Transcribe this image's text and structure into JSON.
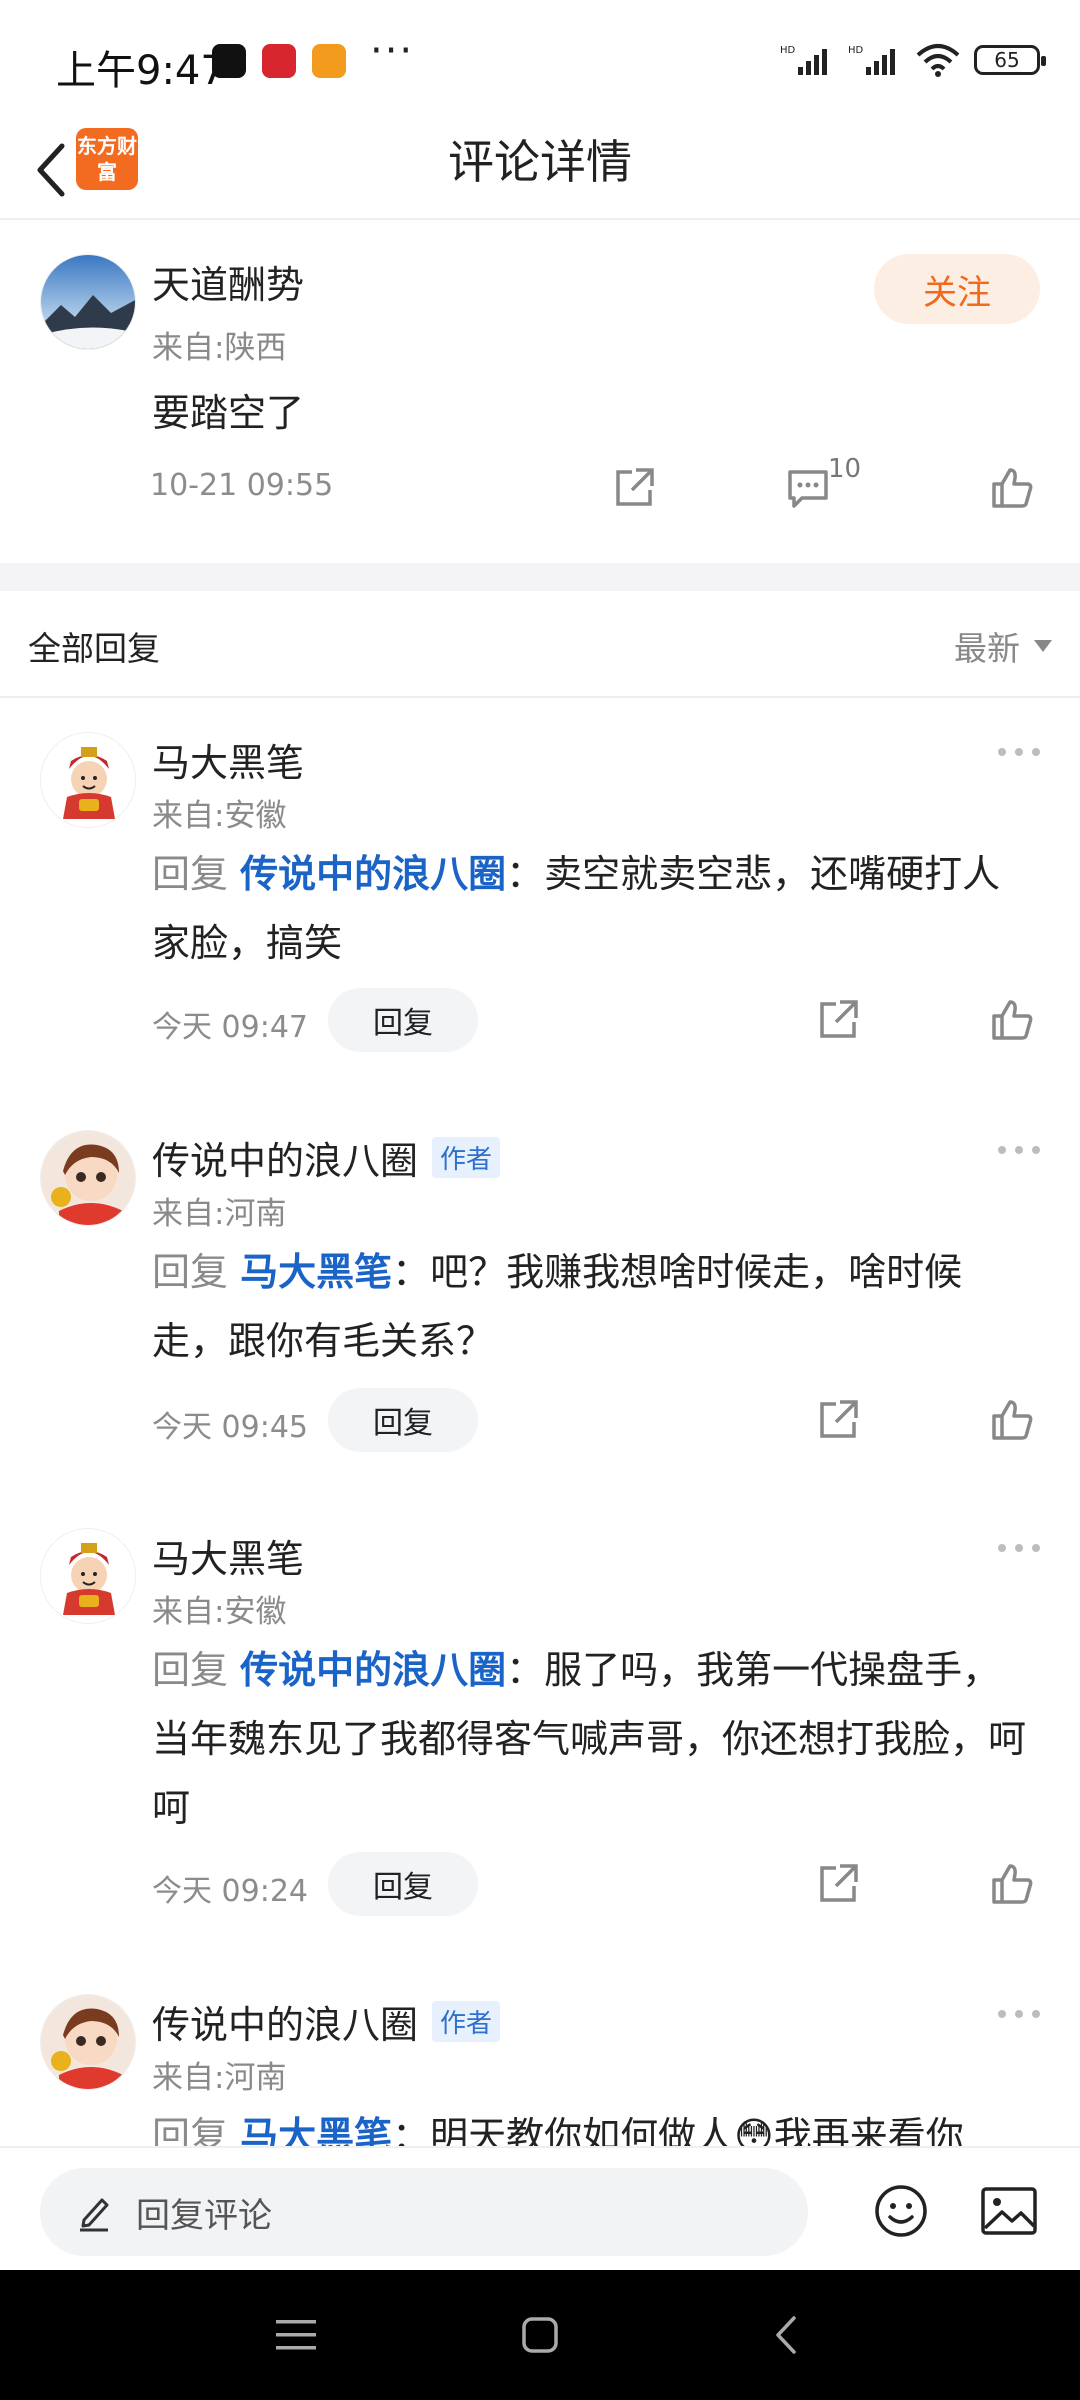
{
  "status_bar": {
    "time": "上午9:47",
    "more": "···",
    "battery": "65"
  },
  "header": {
    "logo_text": "东方财富",
    "title": "评论详情"
  },
  "post": {
    "author": "天道酬势",
    "location": "来自:陕西",
    "content": "要踏空了",
    "time": "10-21 09:55",
    "follow_label": "关注",
    "comment_count": "10"
  },
  "replies": {
    "title": "全部回复",
    "sort_label": "最新",
    "items": [
      {
        "author": "马大黑笔",
        "location": "来自:安徽",
        "reply_word": "回复",
        "mention": "传说中的浪八圈",
        "text": "卖空就卖空悲，还嘴硬打人家脸，搞笑",
        "time": "今天 09:47",
        "reply_button": "回复"
      },
      {
        "author": "传说中的浪八圈",
        "badge": "作者",
        "location": "来自:河南",
        "reply_word": "回复",
        "mention": "马大黑笔",
        "text": "吧？我赚我想啥时候走，啥时候走，跟你有毛关系？",
        "time": "今天 09:45",
        "reply_button": "回复"
      },
      {
        "author": "马大黑笔",
        "location": "来自:安徽",
        "reply_word": "回复",
        "mention": "传说中的浪八圈",
        "text": "服了吗，我第一代操盘手，当年魏东见了我都得客气喊声哥，你还想打我脸，呵呵",
        "time": "今天 09:24",
        "reply_button": "回复"
      },
      {
        "author": "传说中的浪八圈",
        "badge": "作者",
        "location": "来自:河南",
        "reply_word": "回复",
        "mention": "马大黑笔",
        "text": "明天教你如何做人😳我再来看你"
      }
    ]
  },
  "input_bar": {
    "placeholder": "回复评论"
  },
  "colors": {
    "accent_orange": "#ef6a1b",
    "mention_blue": "#1a63c7"
  },
  "icons": [
    "back-arrow-icon",
    "share-icon",
    "comment-icon",
    "like-icon",
    "more-icon",
    "edit-icon",
    "emoji-icon",
    "image-icon",
    "menu-icon",
    "home-icon",
    "back-nav-icon"
  ]
}
